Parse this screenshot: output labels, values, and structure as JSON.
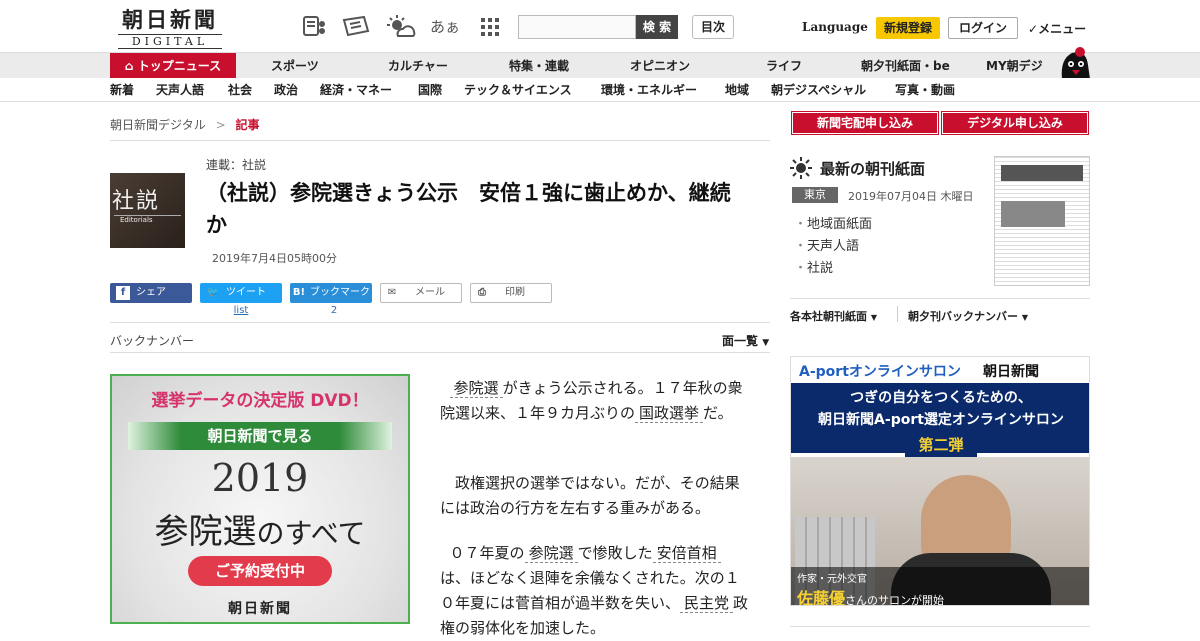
{
  "header": {
    "logo_jp": "朝日新聞",
    "logo_en": "DIGITAL",
    "icons": [
      "news-icon",
      "paper-icon",
      "weather-icon",
      "font-size-icon",
      "grid-icon"
    ],
    "font_size_label": "あぁ",
    "search_placeholder": "",
    "search_button": "検 索",
    "mokuji": "目次",
    "language": "Language",
    "signup": "新規登録",
    "login": "ログイン",
    "menu": "メニュー"
  },
  "nav_primary": [
    "トップニュース",
    "スポーツ",
    "カルチャー",
    "特集・連載",
    "オピニオン",
    "ライフ",
    "朝夕刊紙面・be",
    "MY朝デジ"
  ],
  "nav_secondary": [
    "新着",
    "天声人語",
    "社会",
    "政治",
    "経済・マネー",
    "国際",
    "テック＆サイエンス",
    "環境・エネルギー",
    "地域",
    "朝デジスペシャル",
    "写真・動画"
  ],
  "breadcrumb": {
    "home": "朝日新聞デジタル",
    "separator": ">",
    "current": "記事"
  },
  "article": {
    "thumb_text": "社説",
    "thumb_sub": "Editorials",
    "series": "連載：社説",
    "title": "（社説）参院選きょう公示　安倍１強に歯止めか、継続か",
    "date": "2019年7月4日05時00分",
    "share": {
      "facebook": "シェア",
      "twitter": "ツイート",
      "hatena": "ブックマーク",
      "mail": "メール",
      "print": "印刷"
    },
    "twitter_count": "list",
    "hatena_count": "2",
    "backnumber": "バックナンバー",
    "menpage": "面一覧",
    "paragraphs": [
      {
        "kw1": "参院選",
        "t1": "がきょう公示される。１７年秋の衆院選以来、１年９カ月ぶりの",
        "kw2": "国政選挙",
        "t2": "だ。"
      },
      {
        "t": "政権選択の選挙ではない。だが、その結果には政治の行方を左右する重みがある。"
      },
      {
        "t0": "０７年夏の",
        "kw1": "参院選",
        "t1": "で惨敗した",
        "kw2": "安倍首相",
        "t2": "は、ほどなく退陣を余儀なくされた。次の１０年夏には菅首相が過半数を失い、",
        "kw3": "民主党",
        "t3": "政権の弱体化を加速した。"
      }
    ]
  },
  "ad_left": {
    "headline": "選挙データの決定版 DVD！",
    "band": "朝日新聞で見る",
    "year": "2019",
    "main": "参院選",
    "main2": "のすべて",
    "cta": "ご予約受付中",
    "brand": "朝日新聞"
  },
  "sidebar": {
    "delivery": "新聞宅配申し込み",
    "digital": "デジタル申し込み",
    "chokan_title": "最新の朝刊紙面",
    "region": "東京",
    "date": "2019年07月04日 木曜日",
    "links": [
      "地域面紙面",
      "天声人語",
      "社説"
    ],
    "sub1": "各本社朝刊紙面",
    "sub2": "朝夕刊バックナンバー"
  },
  "ad_right": {
    "brand_left": "A-portオンラインサロン",
    "brand_right": "朝日新聞",
    "line1": "つぎの自分をつくるための、",
    "line2": "朝日新聞A-port選定オンラインサロン",
    "badge": "第二弾",
    "caption_small": "作家・元外交官",
    "caption_name": "佐藤優",
    "caption_rest": "さんのサロンが開始"
  },
  "colors": {
    "brand_red": "#c8102e",
    "signup_yellow": "#f7c800",
    "ad_navy": "#0b2a6b"
  }
}
